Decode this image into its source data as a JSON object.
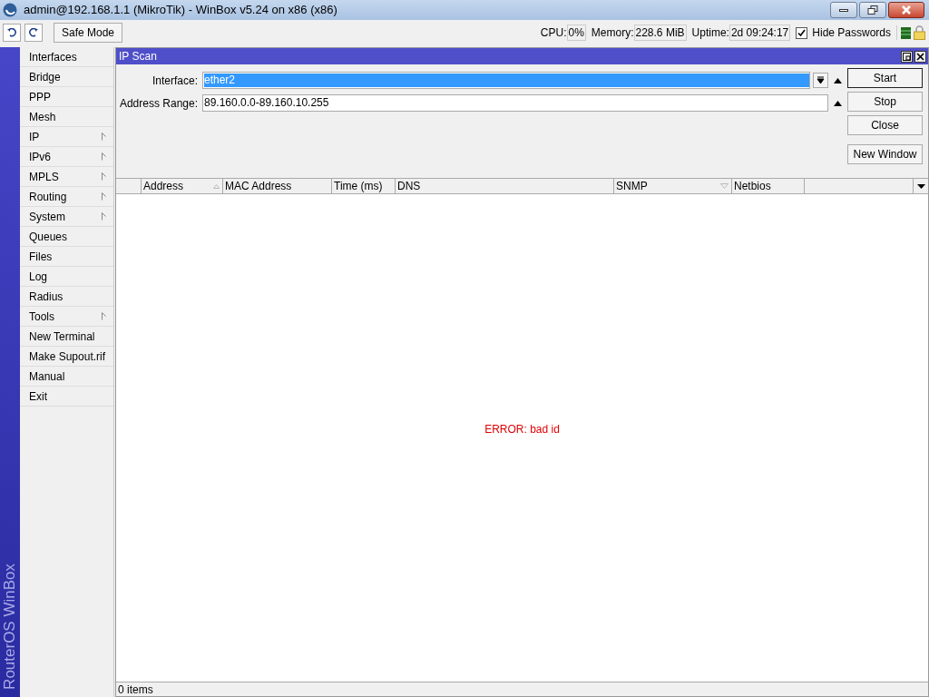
{
  "window": {
    "title": "admin@192.168.1.1 (MikroTik) - WinBox v5.24 on x86 (x86)"
  },
  "toolbar": {
    "safe_mode": "Safe Mode",
    "cpu_label": "CPU:",
    "cpu": "0%",
    "memory_label": "Memory:",
    "memory": "228.6 MiB",
    "uptime_label": "Uptime:",
    "uptime": "2d 09:24:17",
    "hide_passwords": {
      "label": "Hide Passwords",
      "checked": true
    }
  },
  "side_label": "RouterOS WinBox",
  "menu": [
    {
      "label": "Interfaces",
      "submenu": false
    },
    {
      "label": "Bridge",
      "submenu": false
    },
    {
      "label": "PPP",
      "submenu": false
    },
    {
      "label": "Mesh",
      "submenu": false
    },
    {
      "label": "IP",
      "submenu": true
    },
    {
      "label": "IPv6",
      "submenu": true
    },
    {
      "label": "MPLS",
      "submenu": true
    },
    {
      "label": "Routing",
      "submenu": true
    },
    {
      "label": "System",
      "submenu": true
    },
    {
      "label": "Queues",
      "submenu": false
    },
    {
      "label": "Files",
      "submenu": false
    },
    {
      "label": "Log",
      "submenu": false
    },
    {
      "label": "Radius",
      "submenu": false
    },
    {
      "label": "Tools",
      "submenu": true
    },
    {
      "label": "New Terminal",
      "submenu": false
    },
    {
      "label": "Make Supout.rif",
      "submenu": false
    },
    {
      "label": "Manual",
      "submenu": false
    },
    {
      "label": "Exit",
      "submenu": false
    }
  ],
  "ip_scan": {
    "title": "IP Scan",
    "fields": [
      {
        "kind": "dropdown",
        "label": "Interface:",
        "value": "ether2",
        "highlighted": true
      },
      {
        "kind": "text",
        "label": "Address Range:",
        "value": "89.160.0.0-89.160.10.255",
        "highlighted": false
      }
    ],
    "buttons": [
      {
        "label": "Start",
        "default": true
      },
      {
        "label": "Stop",
        "default": false
      },
      {
        "label": "Close",
        "default": false
      },
      {
        "label": "New Window",
        "default": false
      }
    ],
    "columns": [
      {
        "label": "Address",
        "sorted": true,
        "descending": false
      },
      {
        "label": "MAC Address",
        "sorted": false
      },
      {
        "label": "Time (ms)",
        "sorted": false
      },
      {
        "label": "DNS",
        "sorted": false
      },
      {
        "label": "SNMP",
        "sorted": true,
        "descending": true
      },
      {
        "label": "Netbios",
        "sorted": false
      }
    ],
    "message": "ERROR: bad id",
    "status": "0 items"
  }
}
